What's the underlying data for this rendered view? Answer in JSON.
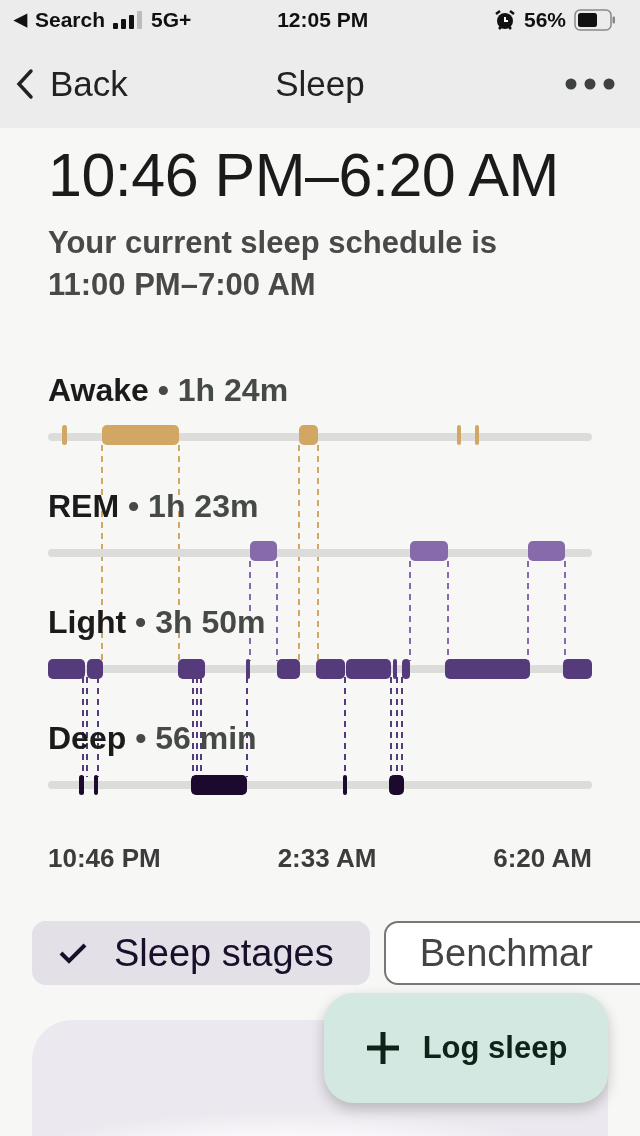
{
  "status_bar": {
    "back_glyph": "◀",
    "back_label": "Search",
    "network": "5G+",
    "time": "12:05 PM",
    "battery": "56%"
  },
  "nav": {
    "back": "Back",
    "title": "Sleep"
  },
  "sleep_range": "10:46 PM–6:20 AM",
  "schedule": "Your current sleep schedule is 11:00 PM–7:00 AM",
  "stages": [
    {
      "kind": "awake",
      "name": "Awake",
      "duration": "• 1h 24m",
      "color": "#d2a764"
    },
    {
      "kind": "rem",
      "name": "REM",
      "duration": "• 1h 23m",
      "color": "#866aab"
    },
    {
      "kind": "light",
      "name": "Light",
      "duration": "• 3h 50m",
      "color": "#553a7c"
    },
    {
      "kind": "deep",
      "name": "Deep",
      "duration": "• 56 min",
      "color": "#1c0a2e"
    }
  ],
  "time_axis": [
    "10:46 PM",
    "2:33 AM",
    "6:20 AM"
  ],
  "chips": [
    {
      "label": "Sleep stages",
      "selected": true
    },
    {
      "label": "Benchmar",
      "selected": false
    }
  ],
  "fab": {
    "label": "Log sleep"
  }
}
